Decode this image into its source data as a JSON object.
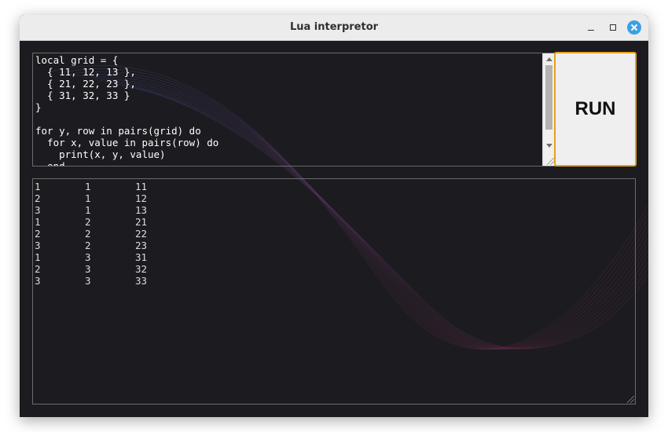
{
  "window": {
    "title": "Lua interpretor"
  },
  "editor": {
    "code": "local grid = {\n  { 11, 12, 13 },\n  { 21, 22, 23 },\n  { 31, 32, 33 }\n}\n\nfor y, row in pairs(grid) do\n  for x, value in pairs(row) do\n    print(x, y, value)\n  end\nend"
  },
  "run_button": {
    "label": "RUN",
    "border_color": "#e3a21a"
  },
  "output": {
    "rows": [
      [
        "1",
        "1",
        "11"
      ],
      [
        "2",
        "1",
        "12"
      ],
      [
        "3",
        "1",
        "13"
      ],
      [
        "1",
        "2",
        "21"
      ],
      [
        "2",
        "2",
        "22"
      ],
      [
        "3",
        "2",
        "23"
      ],
      [
        "1",
        "3",
        "31"
      ],
      [
        "2",
        "3",
        "32"
      ],
      [
        "3",
        "3",
        "33"
      ]
    ]
  },
  "colors": {
    "background": "#1c1b20",
    "close_button": "#3aa0e2",
    "text": "#ffffff"
  },
  "icons": {
    "minimize": "minimize-icon",
    "maximize": "maximize-icon",
    "close": "close-icon"
  }
}
